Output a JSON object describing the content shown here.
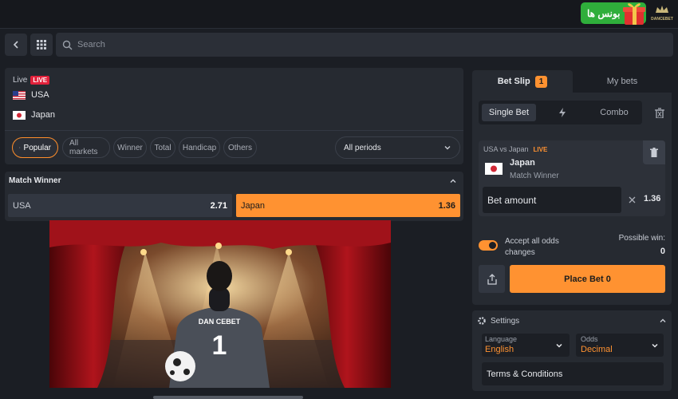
{
  "topbar": {
    "bonus_label": "بونس ها",
    "logo_text": "DANCEBET"
  },
  "nav": {
    "search_placeholder": "Search"
  },
  "match": {
    "live_label": "Live",
    "live_badge": "LIVE",
    "team1": "USA",
    "team2": "Japan"
  },
  "filters": {
    "chips": [
      "Popular",
      "All markets",
      "Winner",
      "Total",
      "Handicap",
      "Others"
    ],
    "active_chip": "Popular",
    "period": "All periods"
  },
  "market": {
    "title": "Match Winner",
    "odds": [
      {
        "team": "USA",
        "value": "2.71"
      },
      {
        "team": "Japan",
        "value": "1.36"
      }
    ]
  },
  "banner": {
    "jersey_text": "DAN CEBET",
    "jersey_number": "1"
  },
  "slip": {
    "tab_betslip": "Bet Slip",
    "tab_count": "1",
    "tab_mybets": "My bets",
    "mode_single": "Single Bet",
    "mode_combo": "Combo",
    "event": "USA vs Japan",
    "event_live": "LIVE",
    "selection": "Japan",
    "market": "Match Winner",
    "amount_placeholder": "Bet amount",
    "odd": "1.36",
    "accept_changes": "Accept all odds changes",
    "possible_win_label": "Possible win:",
    "possible_win_value": "0",
    "place_bet": "Place Bet 0"
  },
  "settings": {
    "title": "Settings",
    "language_label": "Language",
    "language_value": "English",
    "odds_label": "Odds",
    "odds_value": "Decimal",
    "terms": "Terms & Conditions"
  },
  "colors": {
    "accent": "#ff9231",
    "live": "#e2213b",
    "bonus": "#2fae3b",
    "panel": "#262a31",
    "bg": "#1b1e24"
  }
}
